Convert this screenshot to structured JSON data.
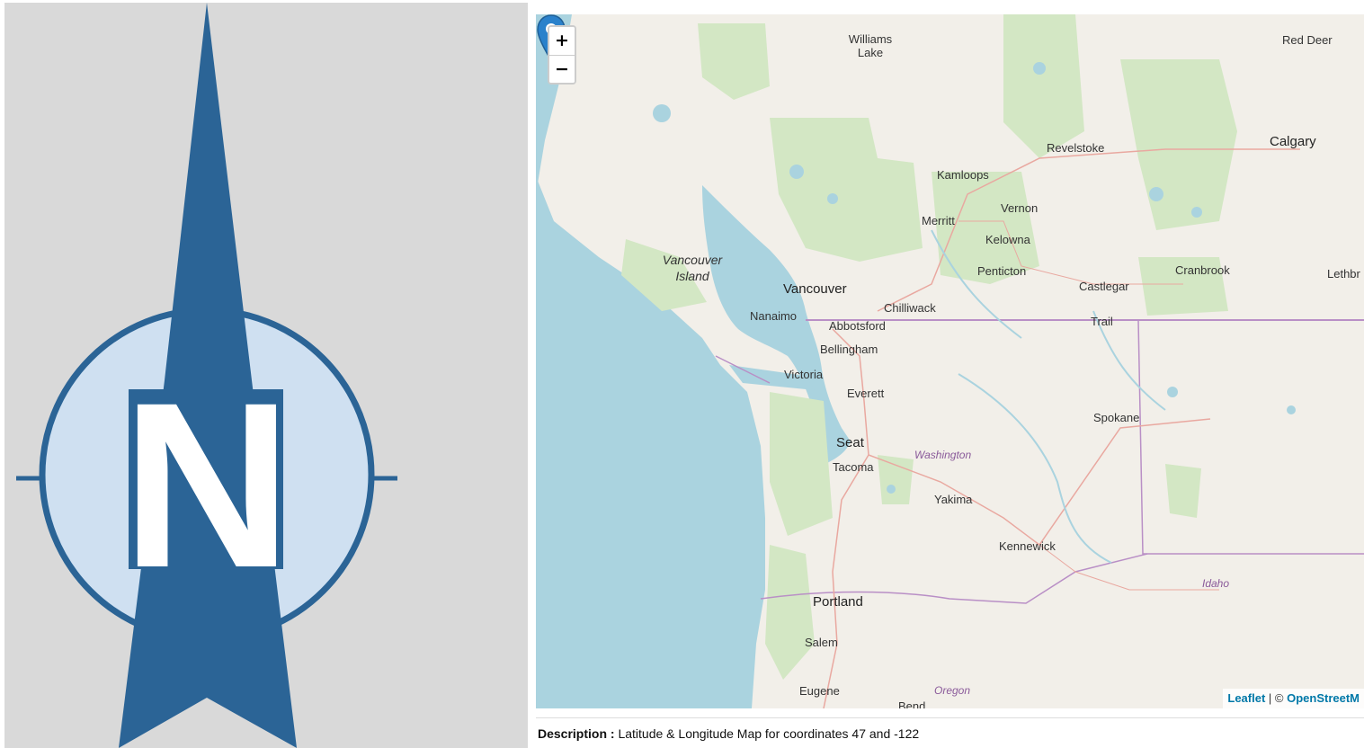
{
  "logo": {
    "letter": "N",
    "colors": {
      "dark": "#2b6496",
      "light": "#cfe0f1",
      "background": "#d9d9d9"
    }
  },
  "map": {
    "zoom_in_label": "+",
    "zoom_out_label": "−",
    "attribution": {
      "leaflet": "Leaflet",
      "separator": " | © ",
      "osm": "OpenStreetM"
    },
    "marker_icon": "map-pin-icon",
    "labels": {
      "williams_lake": "Williams Lake",
      "red_deer": "Red Deer",
      "revelstoke": "Revelstoke",
      "calgary": "Calgary",
      "kamloops": "Kamloops",
      "vernon": "Vernon",
      "merritt": "Merritt",
      "kelowna": "Kelowna",
      "vancouver_island": "Vancouver Island",
      "penticton": "Penticton",
      "cranbrook": "Cranbrook",
      "castlegar": "Castlegar",
      "lethbridge": "Lethbr",
      "vancouver": "Vancouver",
      "chilliwack": "Chilliwack",
      "nanaimo": "Nanaimo",
      "abbotsford": "Abbotsford",
      "trail": "Trail",
      "bellingham": "Bellingham",
      "victoria": "Victoria",
      "everett": "Everett",
      "spokane": "Spokane",
      "seattle": "Seat",
      "tacoma": "Tacoma",
      "washington": "Washington",
      "yakima": "Yakima",
      "kennewick": "Kennewick",
      "idaho": "Idaho",
      "portland": "Portland",
      "salem": "Salem",
      "eugene": "Eugene",
      "oregon": "Oregon",
      "bend": "Bend"
    },
    "colors": {
      "water": "#aad3df",
      "land": "#f2efe9",
      "forest": "#d3e7c4",
      "border": "#b98fc6",
      "road": "#e9a8a0"
    }
  },
  "description": {
    "label": "Description :",
    "text": " Latitude & Longitude Map for coordinates 47 and -122"
  }
}
